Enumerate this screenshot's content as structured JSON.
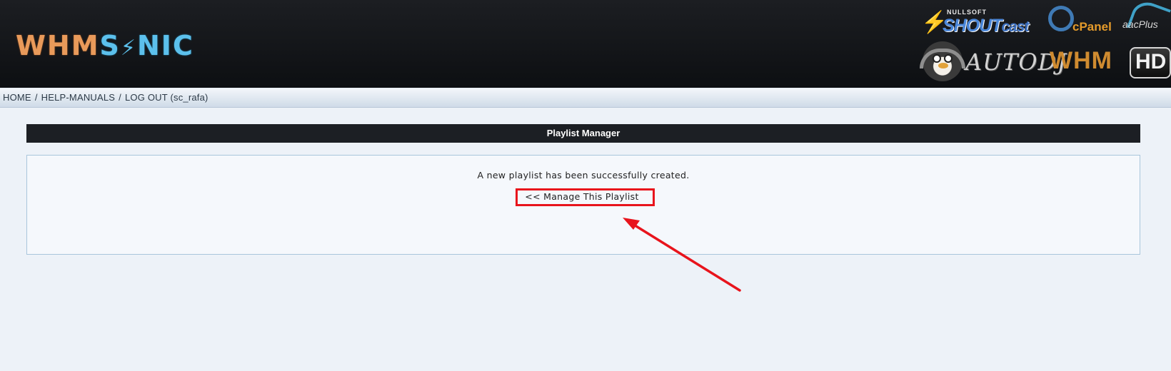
{
  "header": {
    "logo": {
      "part_a": "WHM",
      "part_b": "S",
      "part_c": "NIC"
    },
    "brands": {
      "shoutcast_top": "NULLSOFT",
      "shoutcast_main": "SHOUT",
      "shoutcast_cast": "cast",
      "cpanel": "cPanel",
      "aacplus": "aacPlus",
      "autodj": "AUTODJ",
      "whm": "WHM",
      "hd": "HD"
    },
    "colors": {
      "logo_orange": "#e99a5a",
      "logo_blue": "#5cc0ec",
      "header_bg": "#0d0f12"
    }
  },
  "nav": {
    "items": [
      "HOME",
      "HELP-MANUALS",
      "LOG OUT (sc_rafa)"
    ],
    "separator": "/"
  },
  "panel": {
    "title": "Playlist Manager",
    "message": "A new playlist has been successfully created.",
    "manage_link": "<< Manage This Playlist"
  },
  "annotation": {
    "highlight_color": "#e8141c"
  }
}
